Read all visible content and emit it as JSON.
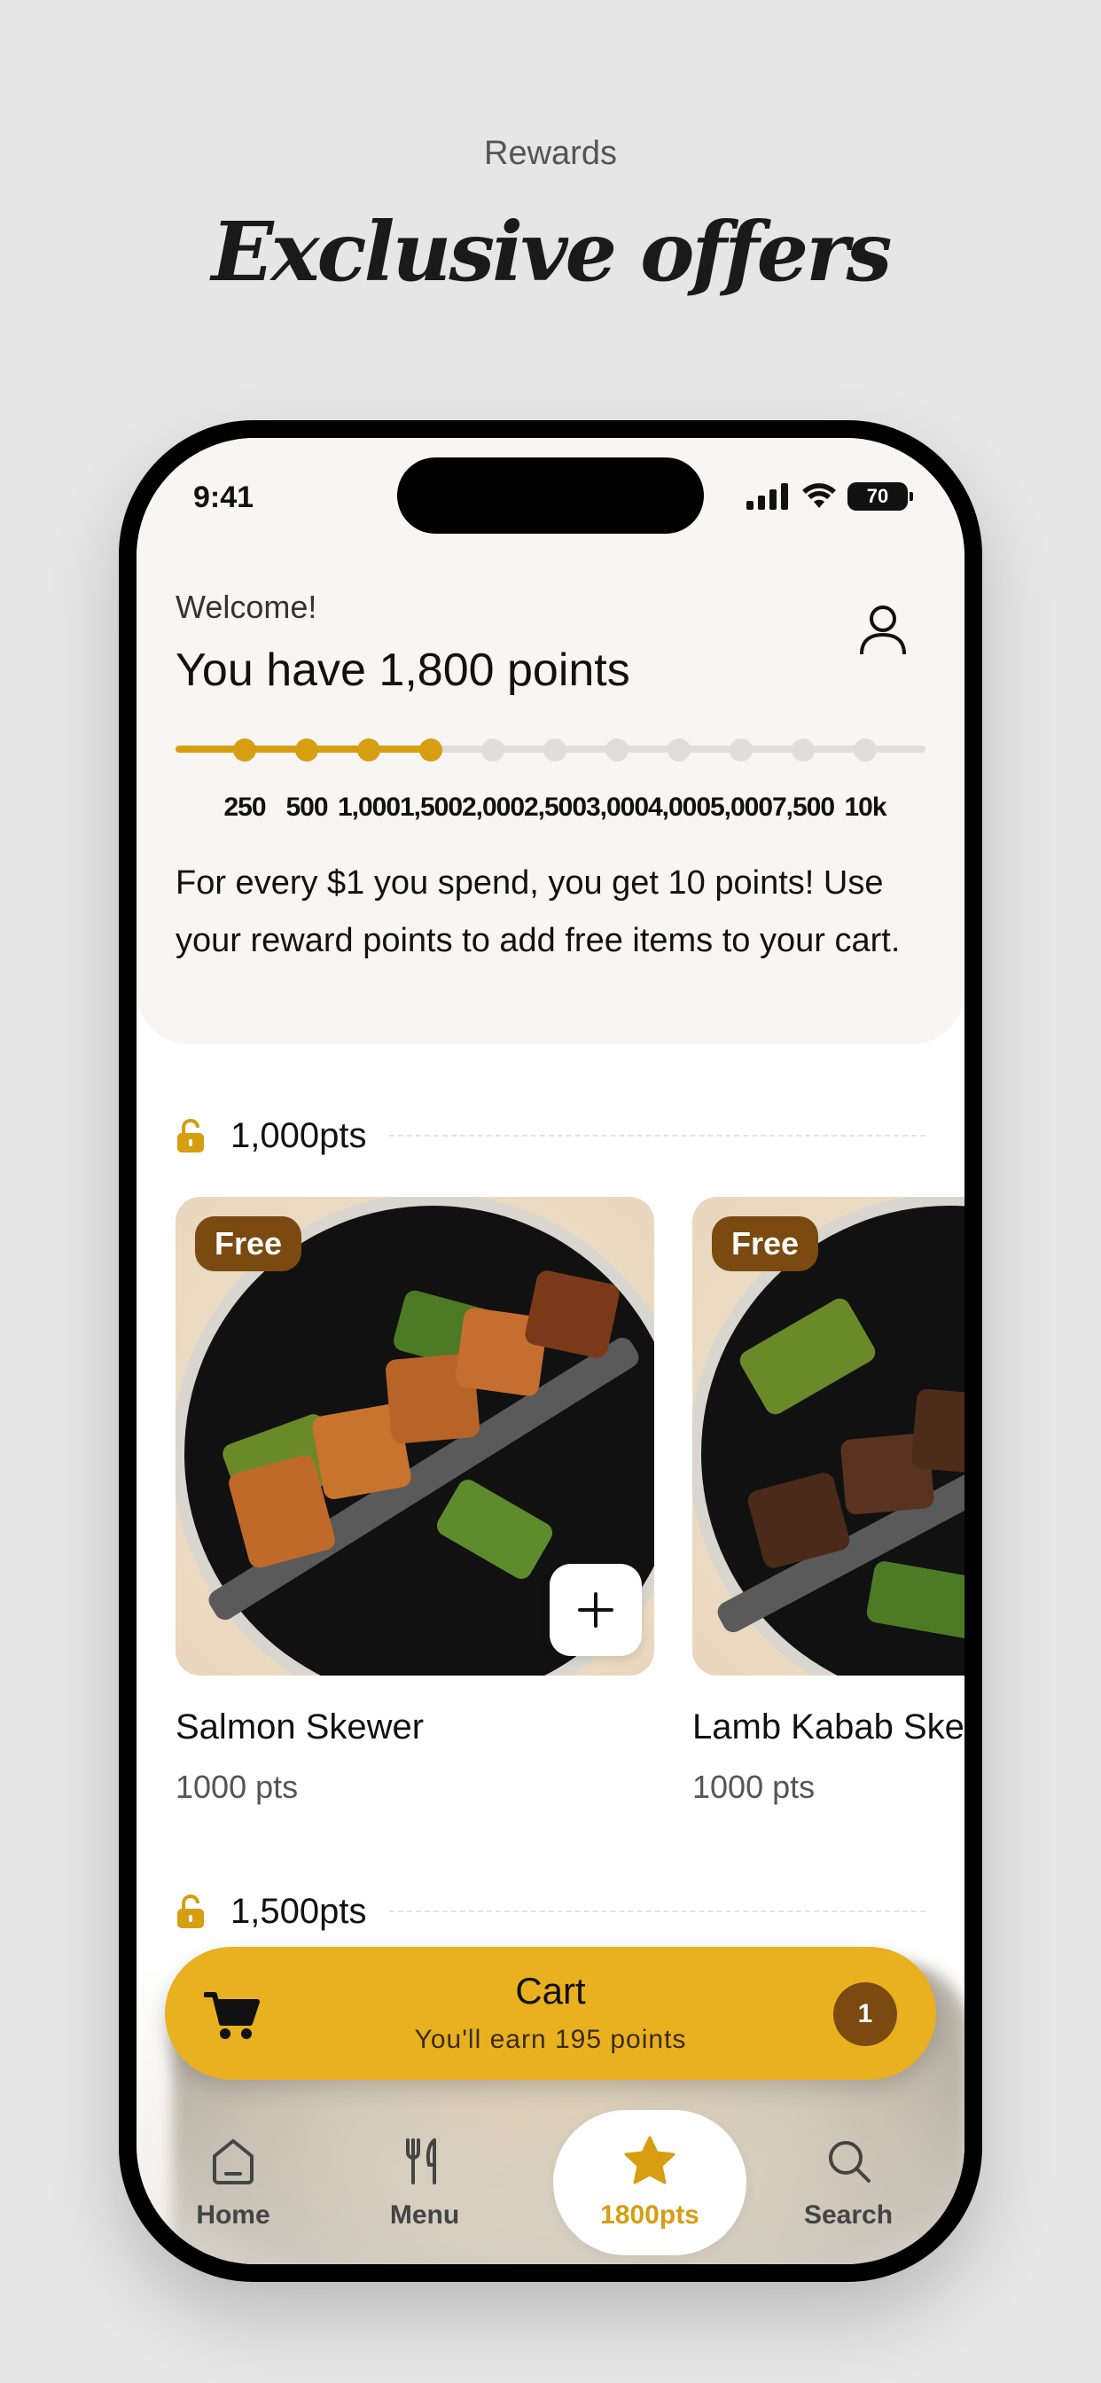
{
  "promo": {
    "eyebrow": "Rewards",
    "title": "Exclusive offers"
  },
  "status_bar": {
    "time": "9:41",
    "battery": "70"
  },
  "header": {
    "welcome": "Welcome!",
    "points_title": "You have 1,800 points",
    "progress": {
      "current_points": 1800,
      "milestones": [
        "250",
        "500",
        "1,000",
        "1,500",
        "2,000",
        "2,500",
        "3,000",
        "4,000",
        "5,000",
        "7,500",
        "10k"
      ],
      "reached_count": 4
    },
    "info_text": "For every $1 you spend, you get 10 points! Use your reward points to add free items to your cart."
  },
  "tiers": [
    {
      "label": "1,000pts",
      "products": [
        {
          "badge": "Free",
          "name": "Salmon Skewer",
          "points": "1000 pts"
        },
        {
          "badge": "Free",
          "name": "Lamb Kabab Skewer",
          "points": "1000 pts"
        }
      ]
    },
    {
      "label": "1,500pts",
      "products": []
    }
  ],
  "cart": {
    "title": "Cart",
    "subtitle": "You'll earn 195 points",
    "count": "1"
  },
  "tabbar": {
    "tabs": [
      {
        "label": "Home",
        "icon": "home-icon"
      },
      {
        "label": "Menu",
        "icon": "utensils-icon"
      },
      {
        "label": "1800pts",
        "icon": "star-icon",
        "active": true
      },
      {
        "label": "Search",
        "icon": "search-icon"
      }
    ]
  },
  "colors": {
    "accent": "#d69e10",
    "cart_bg": "#e9b01f",
    "badge_bg": "#7a4a10",
    "page_bg": "#e6e6e6"
  }
}
